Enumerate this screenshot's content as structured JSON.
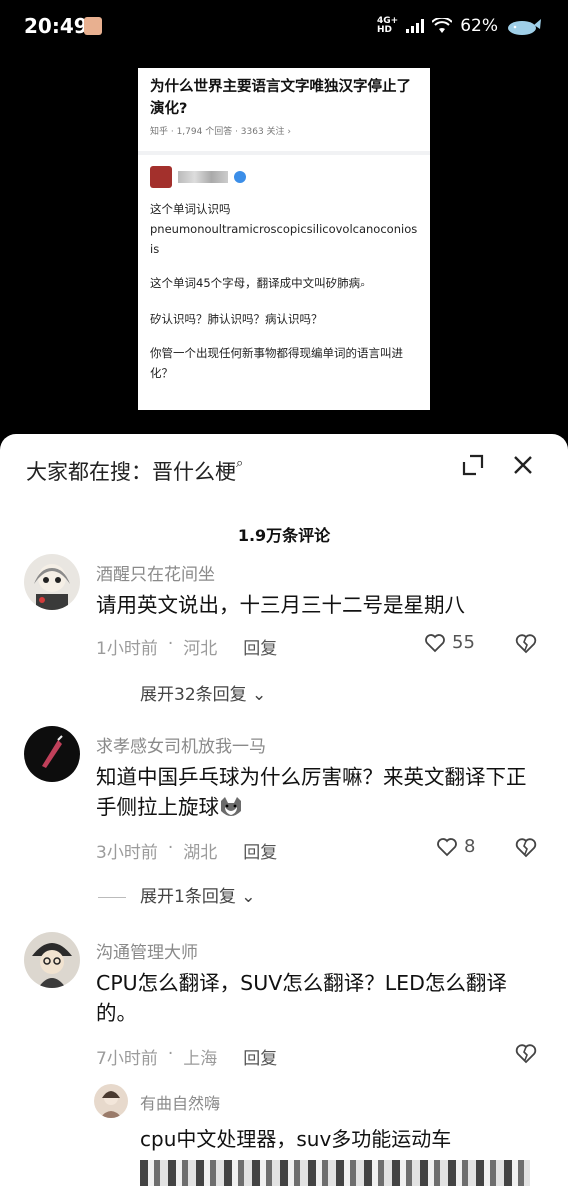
{
  "status": {
    "time": "20:49",
    "network_top": "4G+",
    "network_bottom": "HD",
    "battery": "62%"
  },
  "embed": {
    "question": "为什么世界主要语言文字唯独汉字停止了演化?",
    "meta": "知乎 · 1,794 个回答 · 3363 关注 ›",
    "lines": [
      "这个单词认识吗",
      "pneumonoultramicroscopicsilicovolcanoconiosis",
      "这个单词45个字母，翻译成中文叫矽肺病",
      "矽认识吗？肺认识吗？病认识吗？",
      "你管一个出现任何新事物都得现编单词的语言叫进化？"
    ],
    "search_icon": "search-icon"
  },
  "sheet": {
    "title": "大家都在搜：晋什么梗",
    "comments_count": "1.9万条评论",
    "icons": [
      "expand-icon",
      "close-icon"
    ]
  },
  "comments": [
    {
      "username": "酒醒只在花间坐",
      "content": "请用英文说出，十三月三十二号是星期八",
      "time": "1小时前",
      "location": "河北",
      "reply": "回复",
      "likes": "55",
      "expand": "展开32条回复"
    },
    {
      "username": "求孝感女司机放我一马",
      "content": "知道中国乒乓球为什么厉害嘛？来英文翻译下正手侧拉上旋球",
      "time": "3小时前",
      "location": "湖北",
      "reply": "回复",
      "likes": "8",
      "expand": "展开1条回复"
    },
    {
      "username": "沟通管理大师",
      "content": "CPU怎么翻译，SUV怎么翻译？LED怎么翻译的。",
      "time": "7小时前",
      "location": "上海",
      "reply": "回复"
    }
  ],
  "subreply": {
    "username": "有曲自然嗨",
    "content": "cpu中文处理器，suv多功能运动车"
  },
  "colors": {
    "accent_blue": "#3b8ee8",
    "text_gray": "#8a8a8a"
  }
}
